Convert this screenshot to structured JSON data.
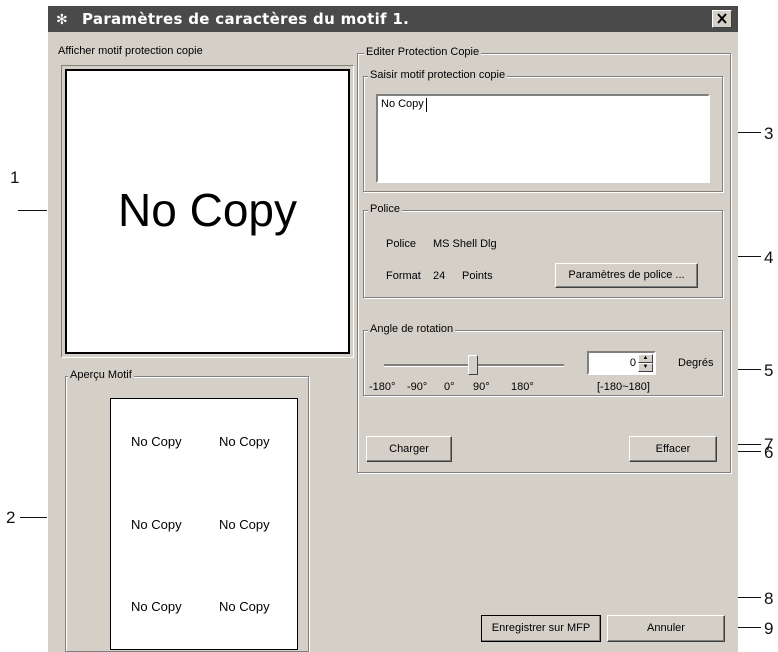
{
  "callouts": {
    "n1": "1",
    "n2": "2",
    "n3": "3",
    "n4": "4",
    "n5": "5",
    "n6": "6",
    "n7": "7",
    "n8": "8",
    "n9": "9"
  },
  "window": {
    "title": "Paramètres de caractères du motif 1."
  },
  "display": {
    "label": "Afficher motif protection copie",
    "text": "No Copy"
  },
  "preview": {
    "label": "Aperçu Motif",
    "items": [
      "No Copy",
      "No Copy",
      "No Copy",
      "No Copy",
      "No Copy",
      "No Copy"
    ]
  },
  "edit": {
    "label": "Editer Protection Copie",
    "input_group_label": "Saisir motif protection copie",
    "input_value": "No Copy"
  },
  "font": {
    "group_label": "Police",
    "police_label": "Police",
    "police_value": "MS Shell Dlg",
    "format_label": "Format",
    "format_value": "24",
    "format_unit": "Points",
    "settings_button": "Paramètres de police ..."
  },
  "rotation": {
    "group_label": "Angle de rotation",
    "value": "0",
    "unit": "Degrés",
    "range": "[-180~180]",
    "slider_level": 0.5,
    "ticks": [
      "-180°",
      "-90°",
      "0°",
      "90°",
      "180°"
    ]
  },
  "buttons": {
    "load": "Charger",
    "clear": "Effacer",
    "save": "Enregistrer sur MFP",
    "cancel": "Annuler"
  }
}
